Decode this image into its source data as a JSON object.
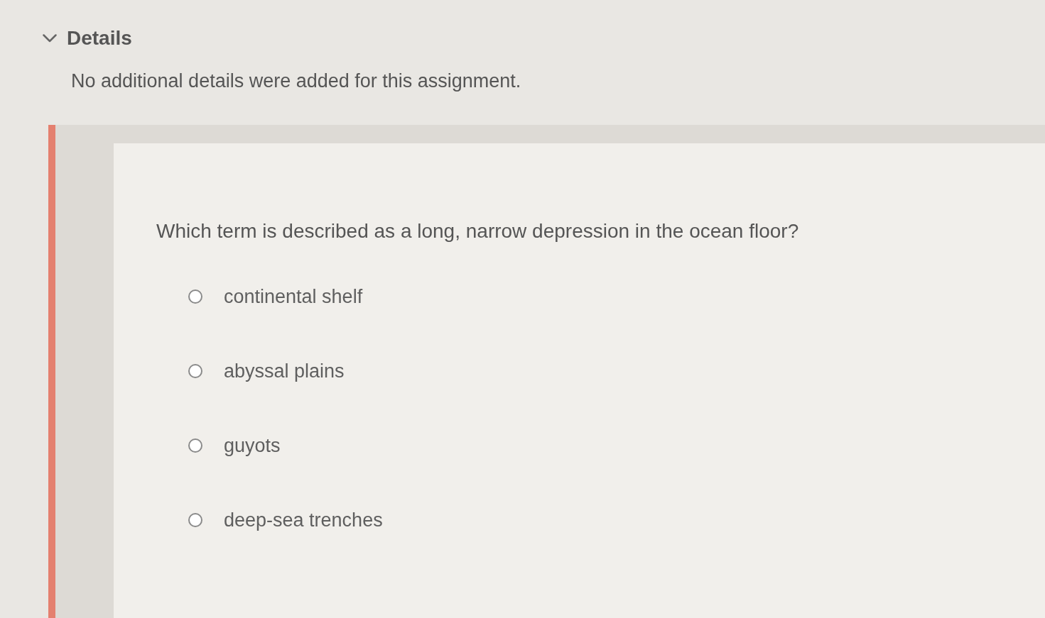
{
  "details": {
    "title": "Details",
    "expanded": true,
    "text": "No additional details were added for this assignment."
  },
  "question": {
    "prompt": "Which term is described as a long, narrow depression in the ocean floor?",
    "options": [
      {
        "label": "continental shelf",
        "selected": false
      },
      {
        "label": "abyssal plains",
        "selected": false
      },
      {
        "label": "guyots",
        "selected": false
      },
      {
        "label": "deep-sea trenches",
        "selected": false
      }
    ]
  }
}
